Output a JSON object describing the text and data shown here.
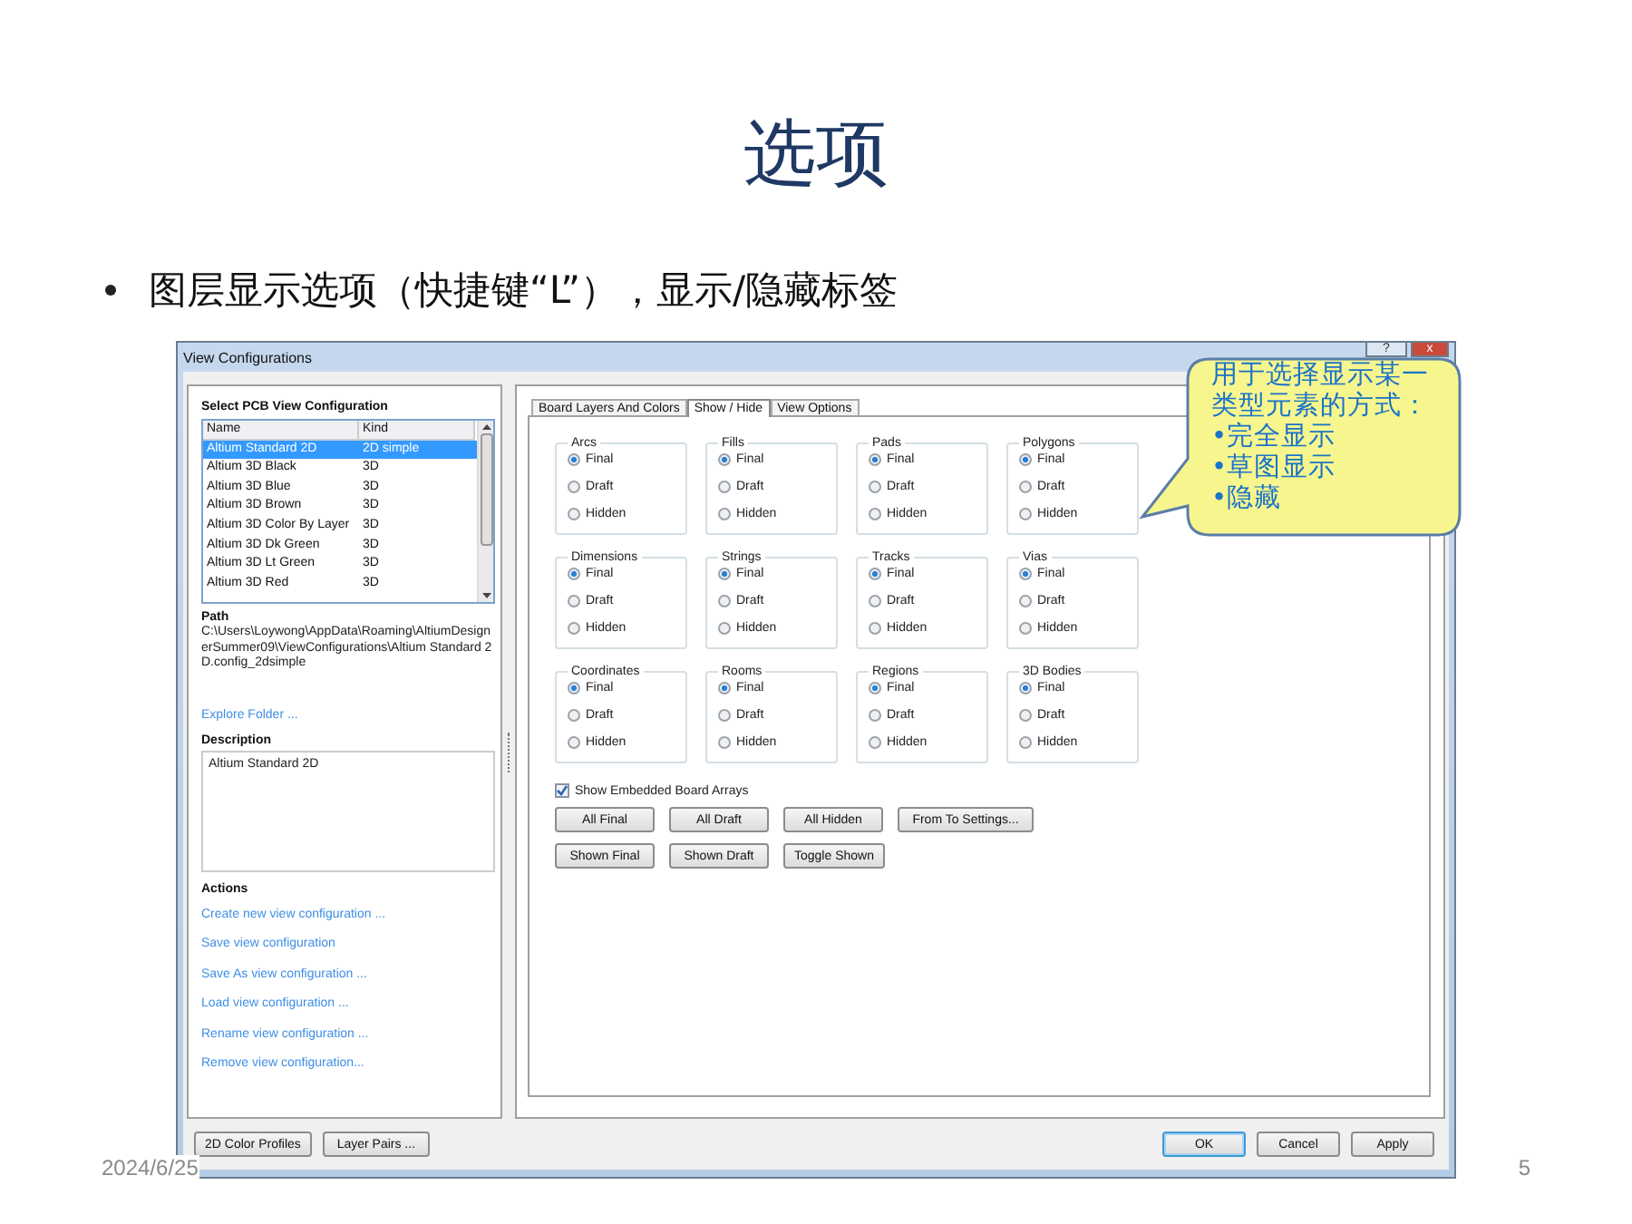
{
  "slide": {
    "title": "选项",
    "bullets": [
      "图层显示选项（快捷键“L”），显示/隐藏标签"
    ],
    "date": "2024/6/25",
    "page_number": "5"
  },
  "window": {
    "title": "View Configurations",
    "help": "?",
    "close": "x",
    "left_panel": {
      "heading": "Select PCB View Configuration",
      "table": {
        "columns": [
          "Name",
          "Kind"
        ],
        "rows": [
          {
            "name": "Altium Standard 2D",
            "kind": "2D simple",
            "selected": true
          },
          {
            "name": "Altium 3D Black",
            "kind": "3D",
            "selected": false
          },
          {
            "name": "Altium 3D Blue",
            "kind": "3D",
            "selected": false
          },
          {
            "name": "Altium 3D Brown",
            "kind": "3D",
            "selected": false
          },
          {
            "name": "Altium 3D Color By Layer",
            "kind": "3D",
            "selected": false
          },
          {
            "name": "Altium 3D Dk Green",
            "kind": "3D",
            "selected": false
          },
          {
            "name": "Altium 3D Lt Green",
            "kind": "3D",
            "selected": false
          },
          {
            "name": "Altium 3D Red",
            "kind": "3D",
            "selected": false
          }
        ]
      },
      "path_label": "Path",
      "path": "C:\\Users\\Loywong\\AppData\\Roaming\\AltiumDesignerSummer09\\ViewConfigurations\\Altium Standard 2D.config_2dsimple",
      "explore_link": "Explore Folder ...",
      "description_label": "Description",
      "description": "Altium Standard 2D",
      "actions_label": "Actions",
      "actions": [
        "Create new view configuration ...",
        "Save view configuration",
        "Save As view configuration ...",
        "Load view configuration ...",
        "Rename view configuration ...",
        "Remove view configuration..."
      ]
    },
    "tabs": [
      {
        "label": "Board Layers And Colors",
        "selected": false
      },
      {
        "label": "Show / Hide",
        "selected": true
      },
      {
        "label": "View Options",
        "selected": false
      }
    ],
    "groups": [
      {
        "label": "Arcs",
        "options": [
          {
            "label": "Final",
            "selected": true
          },
          {
            "label": "Draft",
            "selected": false
          },
          {
            "label": "Hidden",
            "selected": false
          }
        ]
      },
      {
        "label": "Fills",
        "options": [
          {
            "label": "Final",
            "selected": true
          },
          {
            "label": "Draft",
            "selected": false
          },
          {
            "label": "Hidden",
            "selected": false
          }
        ]
      },
      {
        "label": "Pads",
        "options": [
          {
            "label": "Final",
            "selected": true
          },
          {
            "label": "Draft",
            "selected": false
          },
          {
            "label": "Hidden",
            "selected": false
          }
        ]
      },
      {
        "label": "Polygons",
        "options": [
          {
            "label": "Final",
            "selected": true
          },
          {
            "label": "Draft",
            "selected": false
          },
          {
            "label": "Hidden",
            "selected": false
          }
        ]
      },
      {
        "label": "Dimensions",
        "options": [
          {
            "label": "Final",
            "selected": true
          },
          {
            "label": "Draft",
            "selected": false
          },
          {
            "label": "Hidden",
            "selected": false
          }
        ]
      },
      {
        "label": "Strings",
        "options": [
          {
            "label": "Final",
            "selected": true
          },
          {
            "label": "Draft",
            "selected": false
          },
          {
            "label": "Hidden",
            "selected": false
          }
        ]
      },
      {
        "label": "Tracks",
        "options": [
          {
            "label": "Final",
            "selected": true
          },
          {
            "label": "Draft",
            "selected": false
          },
          {
            "label": "Hidden",
            "selected": false
          }
        ]
      },
      {
        "label": "Vias",
        "options": [
          {
            "label": "Final",
            "selected": true
          },
          {
            "label": "Draft",
            "selected": false
          },
          {
            "label": "Hidden",
            "selected": false
          }
        ]
      },
      {
        "label": "Coordinates",
        "options": [
          {
            "label": "Final",
            "selected": true
          },
          {
            "label": "Draft",
            "selected": false
          },
          {
            "label": "Hidden",
            "selected": false
          }
        ]
      },
      {
        "label": "Rooms",
        "options": [
          {
            "label": "Final",
            "selected": true
          },
          {
            "label": "Draft",
            "selected": false
          },
          {
            "label": "Hidden",
            "selected": false
          }
        ]
      },
      {
        "label": "Regions",
        "options": [
          {
            "label": "Final",
            "selected": true
          },
          {
            "label": "Draft",
            "selected": false
          },
          {
            "label": "Hidden",
            "selected": false
          }
        ]
      },
      {
        "label": "3D Bodies",
        "options": [
          {
            "label": "Final",
            "selected": true
          },
          {
            "label": "Draft",
            "selected": false
          },
          {
            "label": "Hidden",
            "selected": false
          }
        ]
      }
    ],
    "show_embedded": {
      "label": "Show Embedded Board Arrays",
      "checked": true
    },
    "button_rows": [
      [
        "All Final",
        "All Draft",
        "All Hidden",
        "From To Settings..."
      ],
      [
        "Shown Final",
        "Shown Draft",
        "Toggle Shown"
      ]
    ],
    "footer_left": [
      "2D Color Profiles",
      "Layer Pairs ..."
    ],
    "footer_right": [
      {
        "label": "OK",
        "default": true
      },
      {
        "label": "Cancel",
        "default": false
      },
      {
        "label": "Apply",
        "default": false
      }
    ]
  },
  "callout": {
    "text": "用于选择显示某一类型元素的方式：",
    "items": [
      "•完全显示",
      "•草图显示",
      "•隐藏"
    ]
  }
}
